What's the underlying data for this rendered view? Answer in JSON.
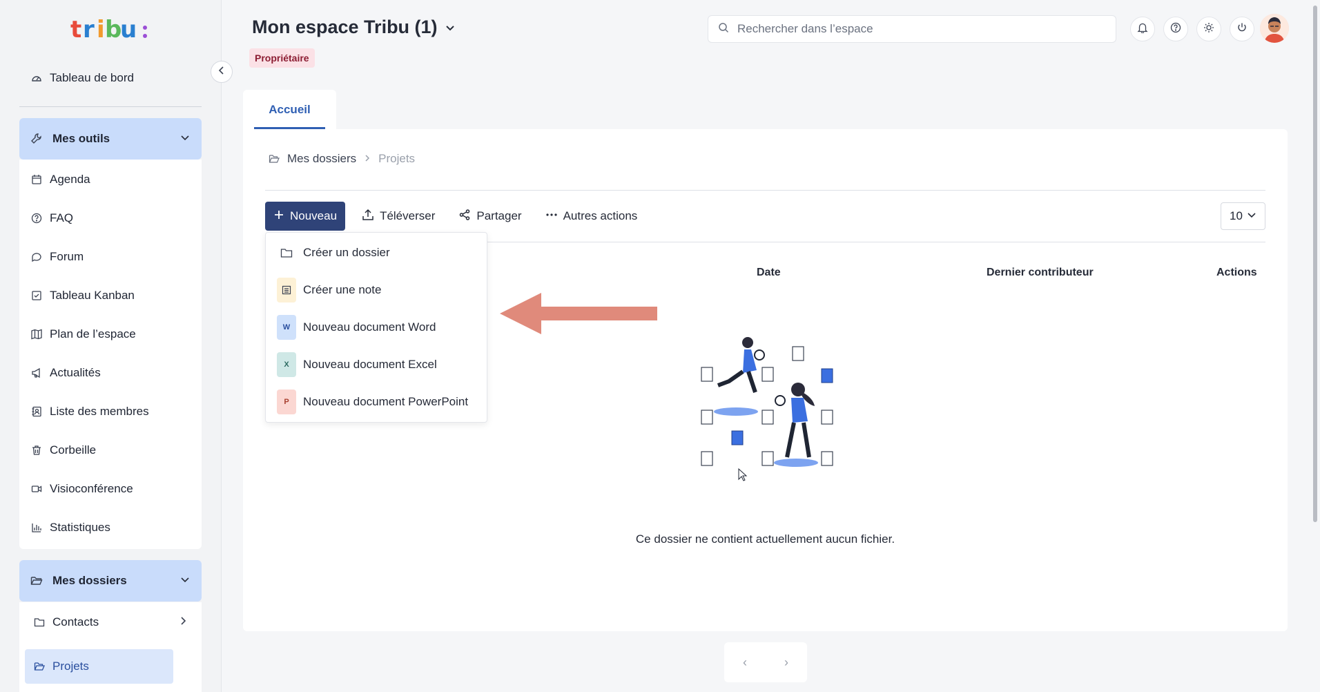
{
  "sidebar": {
    "dashboard": "Tableau de bord",
    "tools_section": "Mes outils",
    "tools": [
      {
        "label": "Agenda",
        "icon": "calendar-icon"
      },
      {
        "label": "FAQ",
        "icon": "help-circle-icon"
      },
      {
        "label": "Forum",
        "icon": "chat-icon"
      },
      {
        "label": "Tableau Kanban",
        "icon": "check-square-icon"
      },
      {
        "label": "Plan de l’espace",
        "icon": "map-icon"
      },
      {
        "label": "Actualités",
        "icon": "megaphone-icon"
      },
      {
        "label": "Liste des membres",
        "icon": "contacts-icon"
      },
      {
        "label": "Corbeille",
        "icon": "trash-icon"
      },
      {
        "label": "Visioconférence",
        "icon": "video-icon"
      },
      {
        "label": "Statistiques",
        "icon": "bar-chart-icon"
      }
    ],
    "folders_section": "Mes dossiers",
    "folders": [
      {
        "label": "Contacts"
      },
      {
        "label": "Projets"
      }
    ]
  },
  "header": {
    "title": "Mon espace Tribu (1)",
    "role": "Propriétaire",
    "search_placeholder": "Rechercher dans l’espace"
  },
  "tabs": [
    {
      "label": "Accueil"
    }
  ],
  "breadcrumb": {
    "root": "Mes dossiers",
    "current": "Projets"
  },
  "toolbar": {
    "new_label": "Nouveau",
    "upload_label": "Téléverser",
    "share_label": "Partager",
    "more_label": "Autres actions",
    "per_page": "10"
  },
  "dropdown": [
    {
      "label": "Créer un dossier",
      "icon_letter": "",
      "color": "#ffffff"
    },
    {
      "label": "Créer une note",
      "icon_letter": "",
      "color": "#fdf1d6"
    },
    {
      "label": "Nouveau document Word",
      "icon_letter": "W",
      "color": "#cfe1fb"
    },
    {
      "label": "Nouveau document Excel",
      "icon_letter": "X",
      "color": "#cfe8e6"
    },
    {
      "label": "Nouveau document PowerPoint",
      "icon_letter": "P",
      "color": "#fbd7d2"
    }
  ],
  "table": {
    "columns": [
      "Date",
      "Dernier contributeur",
      "Actions"
    ]
  },
  "empty_message": "Ce dossier ne contient actuellement aucun fichier.",
  "colors": {
    "accent": "#2f4378",
    "link": "#2f5fb3",
    "annotation_arrow": "#e08a7b"
  }
}
